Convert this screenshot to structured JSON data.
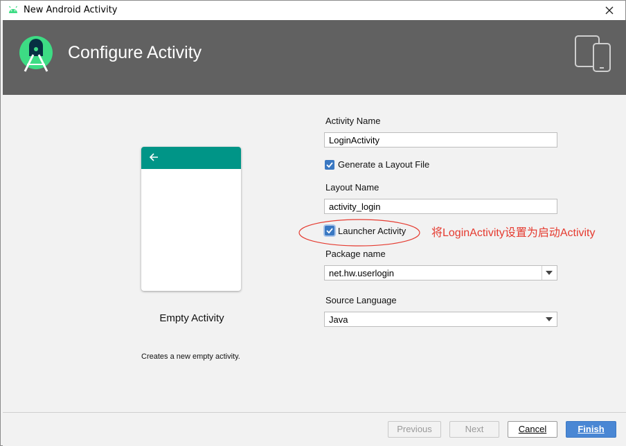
{
  "window": {
    "title": "New Android Activity"
  },
  "banner": {
    "title": "Configure Activity"
  },
  "template": {
    "name": "Empty Activity",
    "description": "Creates a new empty activity."
  },
  "form": {
    "activity_name_label": "Activity Name",
    "activity_name_value": "LoginActivity",
    "generate_layout_label": "Generate a Layout File",
    "generate_layout_checked": true,
    "layout_name_label": "Layout Name",
    "layout_name_value": "activity_login",
    "launcher_label": "Launcher Activity",
    "launcher_checked": true,
    "package_label": "Package name",
    "package_value": "net.hw.userlogin",
    "language_label": "Source Language",
    "language_value": "Java"
  },
  "annotation": {
    "text": "将LoginActivity设置为启动Activity",
    "color": "#e53a2f"
  },
  "buttons": {
    "previous": "Previous",
    "next": "Next",
    "cancel": "Cancel",
    "finish": "Finish"
  },
  "colors": {
    "banner": "#616161",
    "phone_bar": "#009587",
    "accent": "#4a87d4",
    "android_green": "#3ddc84"
  },
  "icons": {
    "title": "android-icon",
    "logo": "android-studio-logo-icon",
    "devices": "devices-icon",
    "back": "arrow-back-icon"
  }
}
